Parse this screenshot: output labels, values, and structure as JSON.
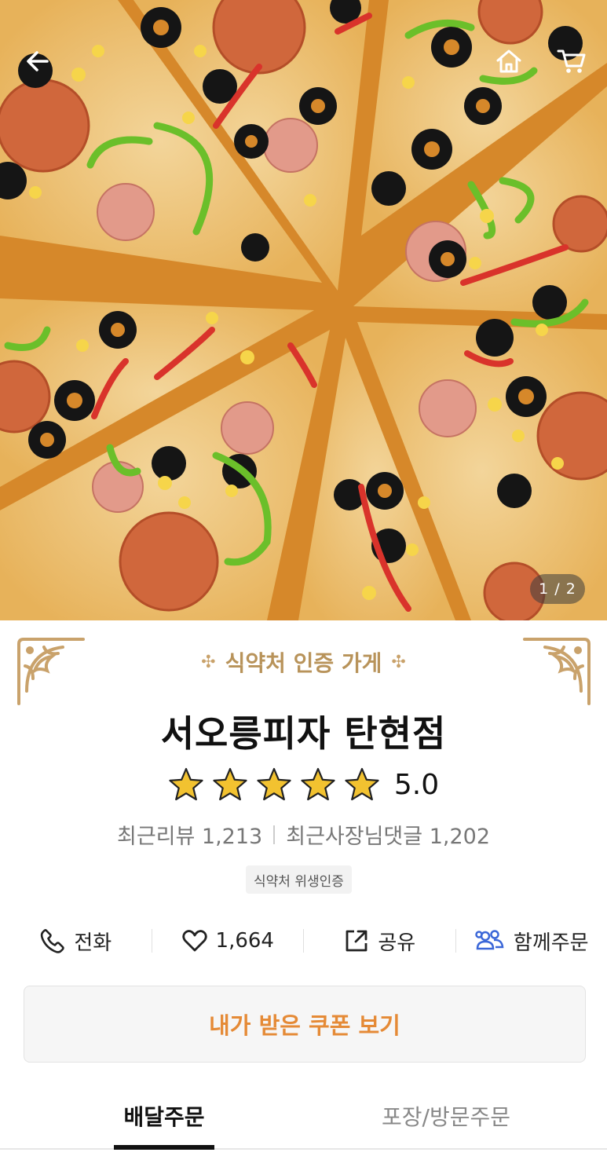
{
  "hero": {
    "image": "pizza-photo",
    "page_indicator": "1 / 2"
  },
  "nav": {
    "back_icon": "back-arrow-icon",
    "home_icon": "home-icon",
    "cart_icon": "cart-icon"
  },
  "store": {
    "certification_banner": "식약처 인증 가게",
    "name": "서오릉피자 탄현점",
    "rating": {
      "stars": 5,
      "score": "5.0"
    },
    "reviews": {
      "recent_reviews": "최근리뷰 1,213",
      "owner_replies": "최근사장님댓글 1,202"
    },
    "hygiene_badge": "식약처 위생인증"
  },
  "actions": {
    "call_label": "전화",
    "like_count": "1,664",
    "share_label": "공유",
    "group_order_label": "함께주문"
  },
  "coupon": {
    "label": "내가 받은 쿠폰 보기"
  },
  "tabs": {
    "delivery": "배달주문",
    "pickup": "포장/방문주문"
  },
  "colors": {
    "accent_orange": "#e58a36",
    "gold": "#b8935a",
    "star": "#f2c230",
    "group_blue": "#3b67d8"
  }
}
